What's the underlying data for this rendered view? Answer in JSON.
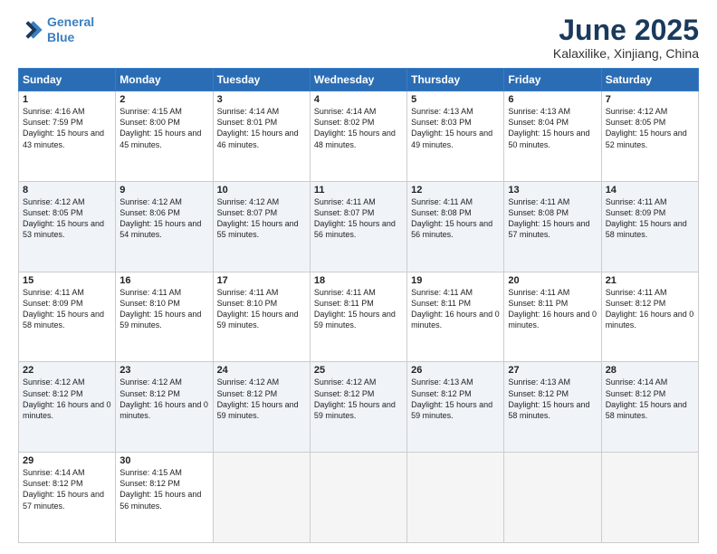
{
  "logo": {
    "line1": "General",
    "line2": "Blue"
  },
  "title": "June 2025",
  "subtitle": "Kalaxilike, Xinjiang, China",
  "weekdays": [
    "Sunday",
    "Monday",
    "Tuesday",
    "Wednesday",
    "Thursday",
    "Friday",
    "Saturday"
  ],
  "weeks": [
    [
      {
        "day": "1",
        "rise": "4:16 AM",
        "set": "7:59 PM",
        "daylight": "15 hours and 43 minutes."
      },
      {
        "day": "2",
        "rise": "4:15 AM",
        "set": "8:00 PM",
        "daylight": "15 hours and 45 minutes."
      },
      {
        "day": "3",
        "rise": "4:14 AM",
        "set": "8:01 PM",
        "daylight": "15 hours and 46 minutes."
      },
      {
        "day": "4",
        "rise": "4:14 AM",
        "set": "8:02 PM",
        "daylight": "15 hours and 48 minutes."
      },
      {
        "day": "5",
        "rise": "4:13 AM",
        "set": "8:03 PM",
        "daylight": "15 hours and 49 minutes."
      },
      {
        "day": "6",
        "rise": "4:13 AM",
        "set": "8:04 PM",
        "daylight": "15 hours and 50 minutes."
      },
      {
        "day": "7",
        "rise": "4:12 AM",
        "set": "8:05 PM",
        "daylight": "15 hours and 52 minutes."
      }
    ],
    [
      {
        "day": "8",
        "rise": "4:12 AM",
        "set": "8:05 PM",
        "daylight": "15 hours and 53 minutes."
      },
      {
        "day": "9",
        "rise": "4:12 AM",
        "set": "8:06 PM",
        "daylight": "15 hours and 54 minutes."
      },
      {
        "day": "10",
        "rise": "4:12 AM",
        "set": "8:07 PM",
        "daylight": "15 hours and 55 minutes."
      },
      {
        "day": "11",
        "rise": "4:11 AM",
        "set": "8:07 PM",
        "daylight": "15 hours and 56 minutes."
      },
      {
        "day": "12",
        "rise": "4:11 AM",
        "set": "8:08 PM",
        "daylight": "15 hours and 56 minutes."
      },
      {
        "day": "13",
        "rise": "4:11 AM",
        "set": "8:08 PM",
        "daylight": "15 hours and 57 minutes."
      },
      {
        "day": "14",
        "rise": "4:11 AM",
        "set": "8:09 PM",
        "daylight": "15 hours and 58 minutes."
      }
    ],
    [
      {
        "day": "15",
        "rise": "4:11 AM",
        "set": "8:09 PM",
        "daylight": "15 hours and 58 minutes."
      },
      {
        "day": "16",
        "rise": "4:11 AM",
        "set": "8:10 PM",
        "daylight": "15 hours and 59 minutes."
      },
      {
        "day": "17",
        "rise": "4:11 AM",
        "set": "8:10 PM",
        "daylight": "15 hours and 59 minutes."
      },
      {
        "day": "18",
        "rise": "4:11 AM",
        "set": "8:11 PM",
        "daylight": "15 hours and 59 minutes."
      },
      {
        "day": "19",
        "rise": "4:11 AM",
        "set": "8:11 PM",
        "daylight": "16 hours and 0 minutes."
      },
      {
        "day": "20",
        "rise": "4:11 AM",
        "set": "8:11 PM",
        "daylight": "16 hours and 0 minutes."
      },
      {
        "day": "21",
        "rise": "4:11 AM",
        "set": "8:12 PM",
        "daylight": "16 hours and 0 minutes."
      }
    ],
    [
      {
        "day": "22",
        "rise": "4:12 AM",
        "set": "8:12 PM",
        "daylight": "16 hours and 0 minutes."
      },
      {
        "day": "23",
        "rise": "4:12 AM",
        "set": "8:12 PM",
        "daylight": "16 hours and 0 minutes."
      },
      {
        "day": "24",
        "rise": "4:12 AM",
        "set": "8:12 PM",
        "daylight": "15 hours and 59 minutes."
      },
      {
        "day": "25",
        "rise": "4:12 AM",
        "set": "8:12 PM",
        "daylight": "15 hours and 59 minutes."
      },
      {
        "day": "26",
        "rise": "4:13 AM",
        "set": "8:12 PM",
        "daylight": "15 hours and 59 minutes."
      },
      {
        "day": "27",
        "rise": "4:13 AM",
        "set": "8:12 PM",
        "daylight": "15 hours and 58 minutes."
      },
      {
        "day": "28",
        "rise": "4:14 AM",
        "set": "8:12 PM",
        "daylight": "15 hours and 58 minutes."
      }
    ],
    [
      {
        "day": "29",
        "rise": "4:14 AM",
        "set": "8:12 PM",
        "daylight": "15 hours and 57 minutes."
      },
      {
        "day": "30",
        "rise": "4:15 AM",
        "set": "8:12 PM",
        "daylight": "15 hours and 56 minutes."
      },
      null,
      null,
      null,
      null,
      null
    ]
  ]
}
